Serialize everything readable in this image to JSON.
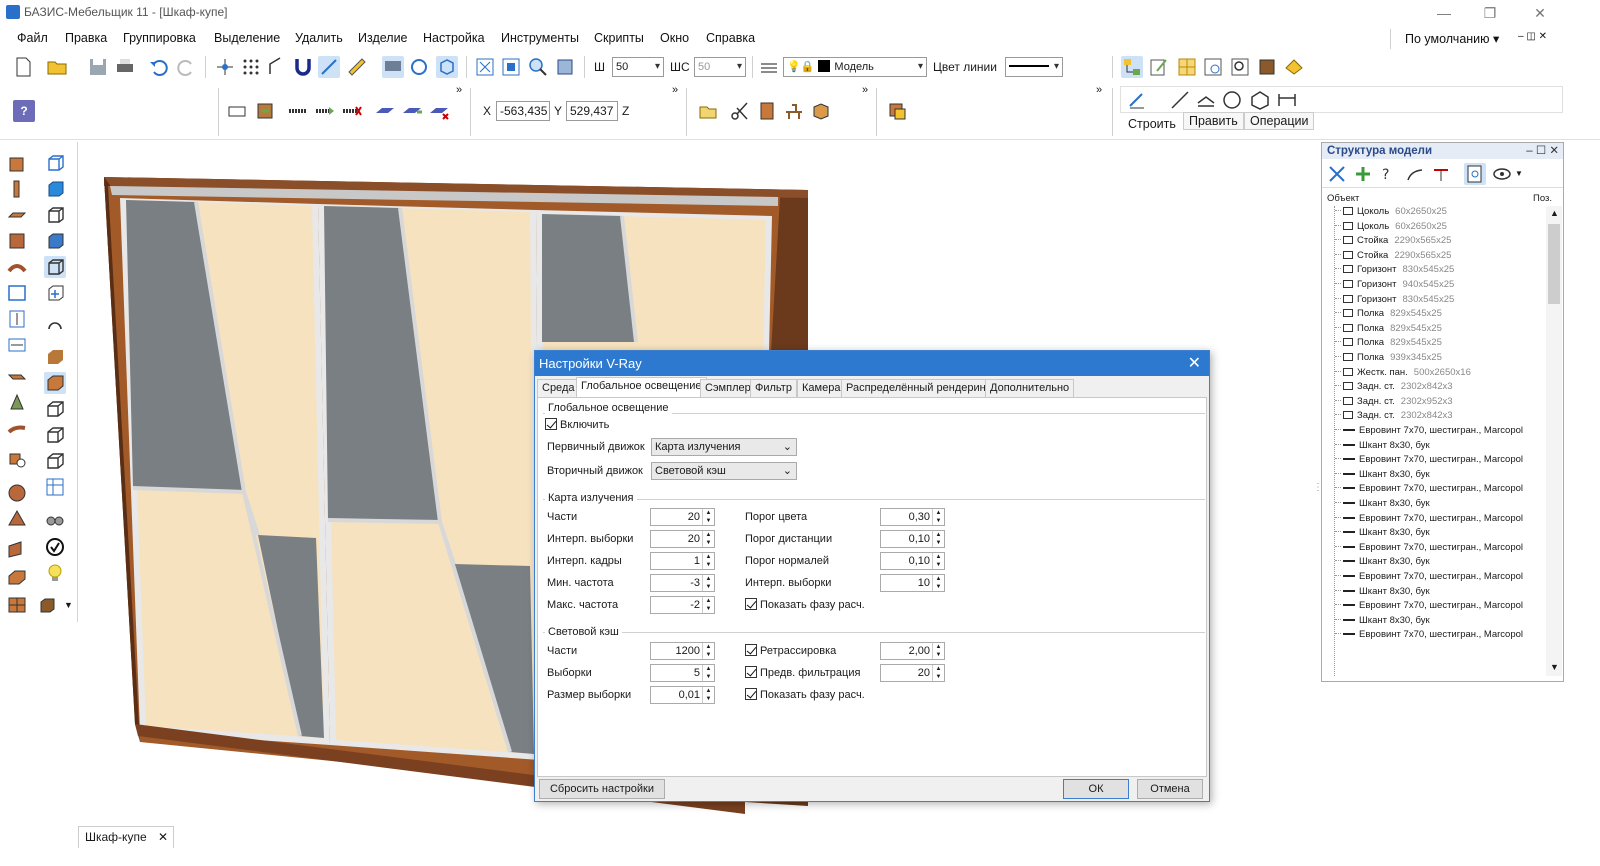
{
  "title_bar": {
    "title": "БАЗИС-Мебельщик 11 - [Шкаф-купе]"
  },
  "menu": [
    "Файл",
    "Правка",
    "Группировка",
    "Выделение",
    "Удалить",
    "Изделие",
    "Настройка",
    "Инструменты",
    "Скрипты",
    "Окно",
    "Справка"
  ],
  "preset": "По умолчанию",
  "toolbar": {
    "line_width": "50",
    "shc_label": "ШС",
    "sh_label": "Ш",
    "shc_value": "50",
    "layer": "Модель",
    "line_color_label": "Цвет линии",
    "x_label": "X",
    "x_value": "-563,435",
    "y_label": "Y",
    "y_value": "529,437",
    "z_label": "Z"
  },
  "right_tabs": [
    "Строить",
    "Править",
    "Операции"
  ],
  "panel": {
    "title": "Структура модели",
    "col_object": "Объект",
    "col_pos": "Поз.",
    "items": [
      {
        "name": "Цоколь",
        "dims": "60x2650x25",
        "icon": "panel"
      },
      {
        "name": "Цоколь",
        "dims": "60x2650x25",
        "icon": "panel"
      },
      {
        "name": "Стойка",
        "dims": "2290x565x25",
        "icon": "panel"
      },
      {
        "name": "Стойка",
        "dims": "2290x565x25",
        "icon": "panel"
      },
      {
        "name": "Горизонт",
        "dims": "830x545x25",
        "icon": "panel"
      },
      {
        "name": "Горизонт",
        "dims": "940x545x25",
        "icon": "panel"
      },
      {
        "name": "Горизонт",
        "dims": "830x545x25",
        "icon": "panel"
      },
      {
        "name": "Полка",
        "dims": "829x545x25",
        "icon": "panel"
      },
      {
        "name": "Полка",
        "dims": "829x545x25",
        "icon": "panel"
      },
      {
        "name": "Полка",
        "dims": "829x545x25",
        "icon": "panel"
      },
      {
        "name": "Полка",
        "dims": "939x345x25",
        "icon": "panel"
      },
      {
        "name": "Жестк. пан.",
        "dims": "500x2650x16",
        "icon": "panel"
      },
      {
        "name": "Задн. ст.",
        "dims": "2302x842x3",
        "icon": "panel"
      },
      {
        "name": "Задн. ст.",
        "dims": "2302x952x3",
        "icon": "panel"
      },
      {
        "name": "Задн. ст.",
        "dims": "2302x842x3",
        "icon": "panel"
      },
      {
        "name": "Евровинт 7x70, шестигран., Marcopol",
        "dims": "",
        "icon": "screw"
      },
      {
        "name": "Шкант 8x30, бук",
        "dims": "",
        "icon": "screw"
      },
      {
        "name": "Евровинт 7x70, шестигран., Marcopol",
        "dims": "",
        "icon": "screw"
      },
      {
        "name": "Шкант 8x30, бук",
        "dims": "",
        "icon": "screw"
      },
      {
        "name": "Евровинт 7x70, шестигран., Marcopol",
        "dims": "",
        "icon": "screw"
      },
      {
        "name": "Шкант 8x30, бук",
        "dims": "",
        "icon": "screw"
      },
      {
        "name": "Евровинт 7x70, шестигран., Marcopol",
        "dims": "",
        "icon": "screw"
      },
      {
        "name": "Шкант 8x30, бук",
        "dims": "",
        "icon": "screw"
      },
      {
        "name": "Евровинт 7x70, шестигран., Marcopol",
        "dims": "",
        "icon": "screw"
      },
      {
        "name": "Шкант 8x30, бук",
        "dims": "",
        "icon": "screw"
      },
      {
        "name": "Евровинт 7x70, шестигран., Marcopol",
        "dims": "",
        "icon": "screw"
      },
      {
        "name": "Шкант 8x30, бук",
        "dims": "",
        "icon": "screw"
      },
      {
        "name": "Евровинт 7x70, шестигран., Marcopol",
        "dims": "",
        "icon": "screw"
      },
      {
        "name": "Шкант 8x30, бук",
        "dims": "",
        "icon": "screw"
      },
      {
        "name": "Евровинт 7x70, шестигран., Marcopol",
        "dims": "",
        "icon": "screw"
      }
    ]
  },
  "dialog": {
    "title": "Настройки V-Ray",
    "tabs": [
      "Среда",
      "Глобальное освещение",
      "Сэмплер",
      "Фильтр",
      "Камера",
      "Распределённый рендеринг",
      "Дополнительно"
    ],
    "gi": {
      "title": "Глобальное освещение",
      "enable": "Включить",
      "primary_label": "Первичный движок",
      "primary_value": "Карта излучения",
      "secondary_label": "Вторичный движок",
      "secondary_value": "Световой кэш"
    },
    "irr": {
      "title": "Карта излучения",
      "left": [
        {
          "label": "Части",
          "value": "20"
        },
        {
          "label": "Интерп. выборки",
          "value": "20"
        },
        {
          "label": "Интерп. кадры",
          "value": "1"
        },
        {
          "label": "Мин. частота",
          "value": "-3"
        },
        {
          "label": "Макс. частота",
          "value": "-2"
        }
      ],
      "right": [
        {
          "label": "Порог цвета",
          "value": "0,30"
        },
        {
          "label": "Порог дистанции",
          "value": "0,10"
        },
        {
          "label": "Порог нормалей",
          "value": "0,10"
        },
        {
          "label": "Интерп. выборки",
          "value": "10"
        }
      ],
      "show_phase": "Показать фазу расч."
    },
    "lc": {
      "title": "Световой кэш",
      "left": [
        {
          "label": "Части",
          "value": "1200"
        },
        {
          "label": "Выборки",
          "value": "5"
        },
        {
          "label": "Размер выборки",
          "value": "0,01"
        }
      ],
      "retrace": "Ретрассировка",
      "retrace_value": "2,00",
      "prefilter": "Предв. фильтрация",
      "prefilter_value": "20",
      "show_phase": "Показать фазу расч."
    },
    "reset": "Сбросить настройки",
    "ok": "ОК",
    "cancel": "Отмена"
  },
  "doc_tab": "Шкаф-купе"
}
